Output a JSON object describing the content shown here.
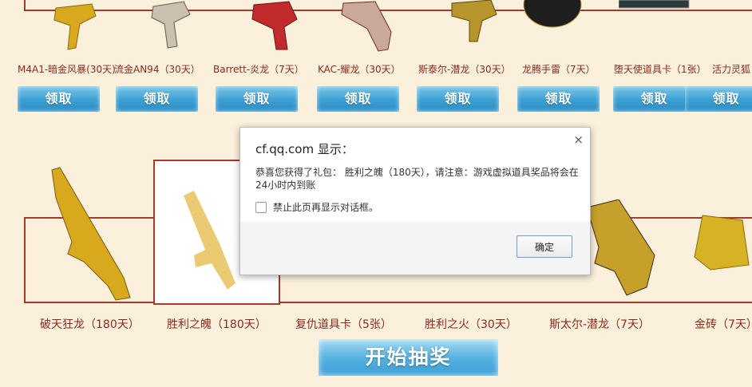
{
  "row1": {
    "items": [
      {
        "name": "M4A1-暗金风暴(30天)",
        "claim": "领取"
      },
      {
        "name": "流金AN94（30天）",
        "claim": "领取"
      },
      {
        "name": "Barrett-炎龙（7天）",
        "claim": "领取"
      },
      {
        "name": "KAC-耀龙（30天）",
        "claim": "领取"
      },
      {
        "name": "斯泰尔-潜龙（30天）",
        "claim": "领取"
      },
      {
        "name": "龙腾手雷（7天）",
        "claim": "领取"
      },
      {
        "name": "堕天使道具卡（1张）",
        "claim": "领取"
      },
      {
        "name": "活力灵狐",
        "claim": "领取"
      }
    ]
  },
  "row2": {
    "items": [
      {
        "name": "破天狂龙（180天）"
      },
      {
        "name": "胜利之魄（180天）"
      },
      {
        "name": "复仇道具卡（5张）"
      },
      {
        "name": "胜利之火（30天）"
      },
      {
        "name": "斯太尔-潜龙（7天）"
      },
      {
        "name": "金砖（7天）"
      }
    ]
  },
  "start_button": "开始抽奖",
  "dialog": {
    "title": "cf.qq.com 显示：",
    "message": "恭喜您获得了礼包： 胜利之魄（180天），请注意：游戏虚拟道具奖品将会在24小时内到账",
    "checkbox_label": "禁止此页再显示对话框。",
    "ok_label": "确定",
    "close_glyph": "×"
  },
  "colors": {
    "accent_red": "#a33a2a",
    "button_blue": "#3b9fd2",
    "gold": "#d4a017"
  }
}
